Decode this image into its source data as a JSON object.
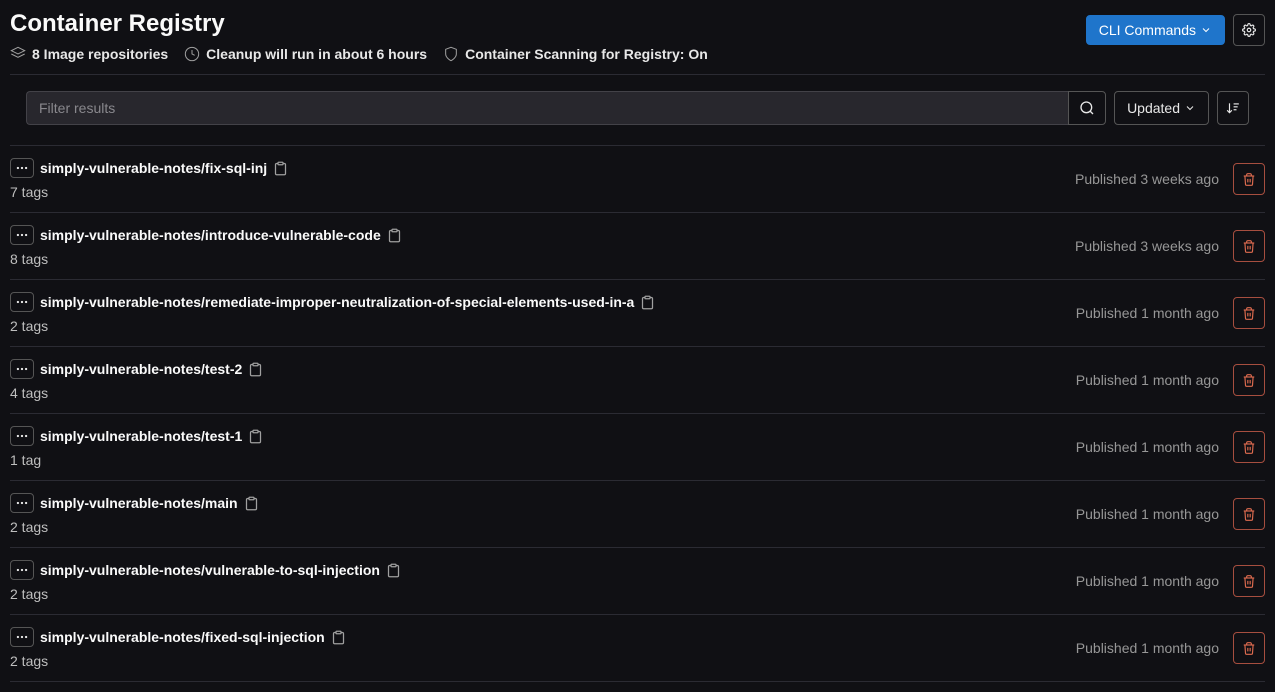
{
  "header": {
    "title": "Container Registry",
    "cli_button": "CLI Commands",
    "repo_count": "8 Image repositories",
    "cleanup": "Cleanup will run in about 6 hours",
    "scanning": "Container Scanning for Registry: On"
  },
  "toolbar": {
    "filter_placeholder": "Filter results",
    "sort_label": "Updated"
  },
  "repos": [
    {
      "name": "simply-vulnerable-notes/fix-sql-inj",
      "tags": "7 tags",
      "published": "Published 3 weeks ago"
    },
    {
      "name": "simply-vulnerable-notes/introduce-vulnerable-code",
      "tags": "8 tags",
      "published": "Published 3 weeks ago"
    },
    {
      "name": "simply-vulnerable-notes/remediate-improper-neutralization-of-special-elements-used-in-a",
      "tags": "2 tags",
      "published": "Published 1 month ago"
    },
    {
      "name": "simply-vulnerable-notes/test-2",
      "tags": "4 tags",
      "published": "Published 1 month ago"
    },
    {
      "name": "simply-vulnerable-notes/test-1",
      "tags": "1 tag",
      "published": "Published 1 month ago"
    },
    {
      "name": "simply-vulnerable-notes/main",
      "tags": "2 tags",
      "published": "Published 1 month ago"
    },
    {
      "name": "simply-vulnerable-notes/vulnerable-to-sql-injection",
      "tags": "2 tags",
      "published": "Published 1 month ago"
    },
    {
      "name": "simply-vulnerable-notes/fixed-sql-injection",
      "tags": "2 tags",
      "published": "Published 1 month ago"
    }
  ]
}
